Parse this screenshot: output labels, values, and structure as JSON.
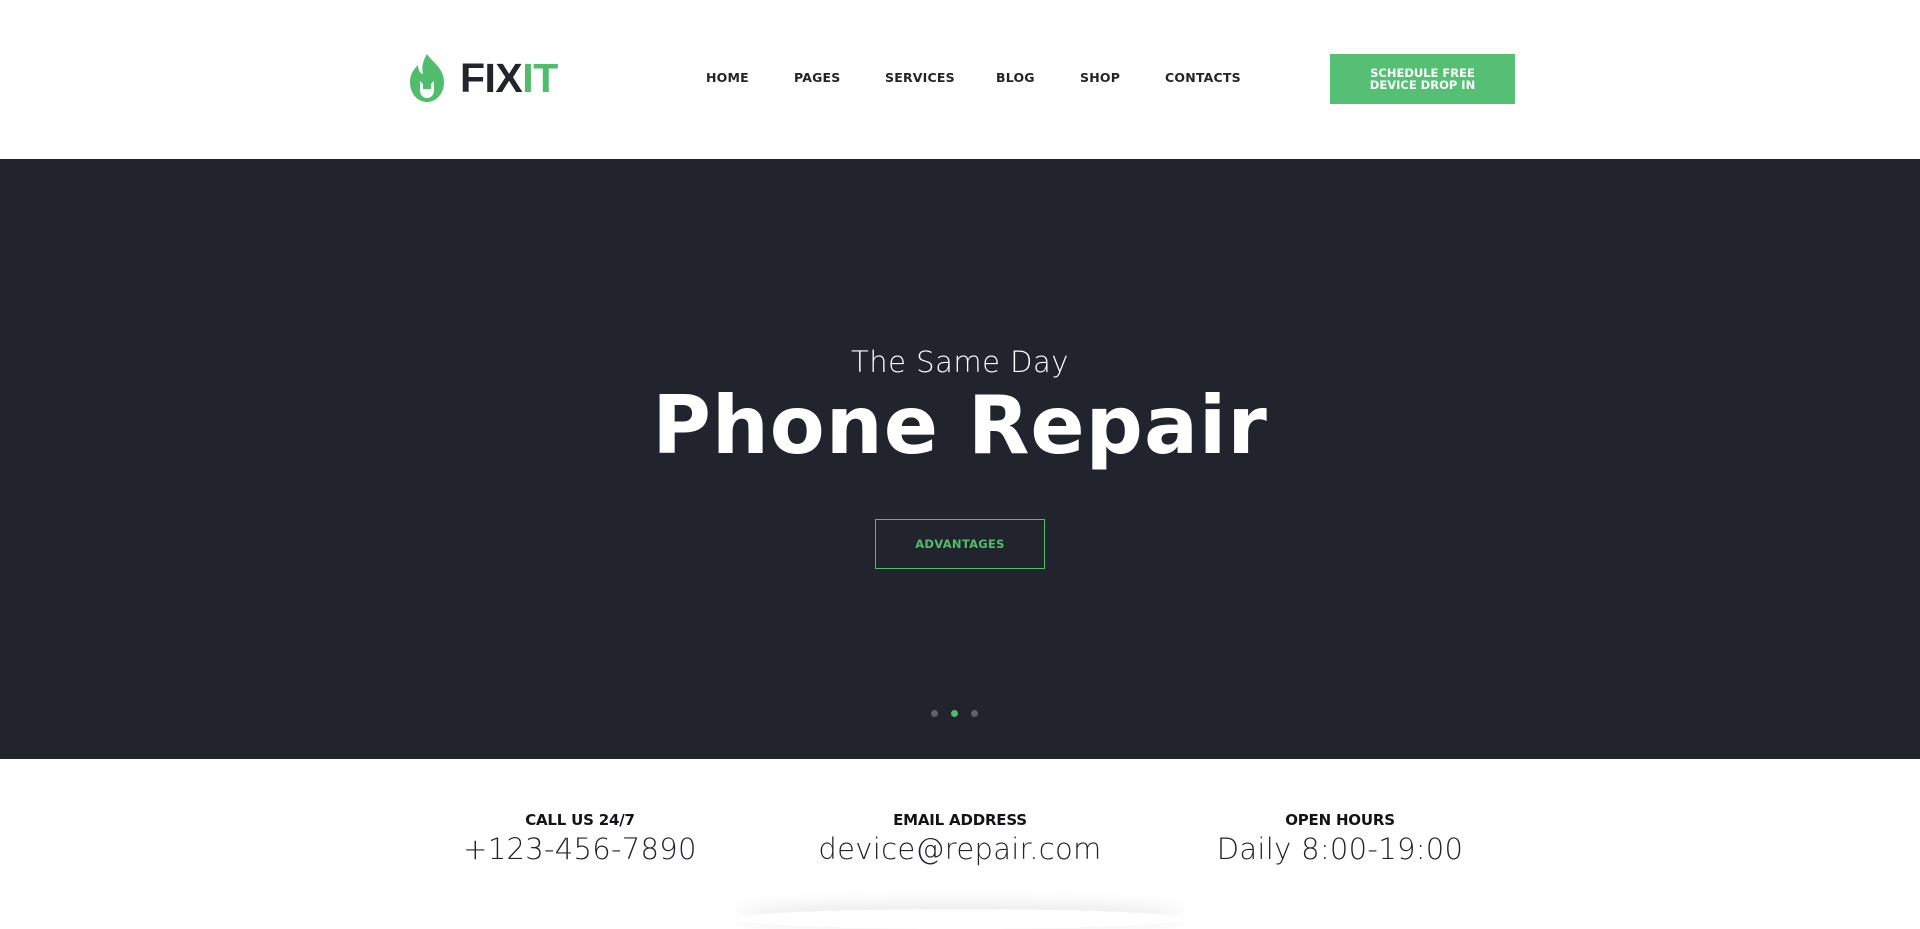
{
  "brand": {
    "logo_fix": "FIX",
    "logo_it": "IT",
    "logo_icon": "flame-wrench-icon",
    "accent_color": "#4fbd6b",
    "dark_color": "#21242d"
  },
  "nav": {
    "items": [
      {
        "label": "HOME"
      },
      {
        "label": "PAGES"
      },
      {
        "label": "SERVICES"
      },
      {
        "label": "BLOG"
      },
      {
        "label": "SHOP"
      },
      {
        "label": "CONTACTS"
      }
    ]
  },
  "header_cta": {
    "line1": "SCHEDULE FREE",
    "line2": "DEVICE DROP IN"
  },
  "hero": {
    "subtitle": "The Same Day",
    "title": "Phone Repair",
    "button_label": "ADVANTAGES",
    "slider": {
      "count": 3,
      "active_index": 1
    }
  },
  "info": [
    {
      "label": "CALL US 24/7",
      "value": "+123-456-7890"
    },
    {
      "label": "EMAIL ADDRESS",
      "value": "device@repair.com"
    },
    {
      "label": "OPEN HOURS",
      "value": "Daily 8:00-19:00"
    }
  ]
}
